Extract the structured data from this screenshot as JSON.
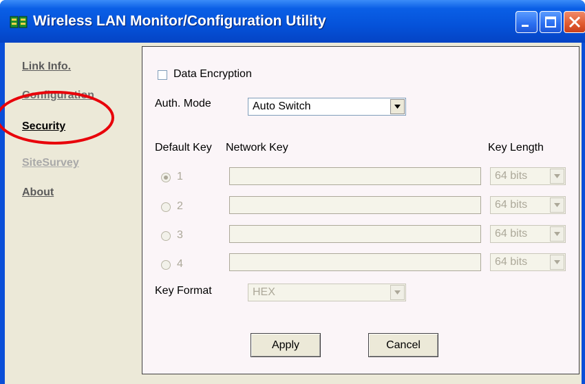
{
  "window": {
    "title": "Wireless LAN Monitor/Configuration Utility",
    "app_icon": "network-card-icon",
    "controls": [
      "minimize-icon",
      "maximize-icon",
      "close-icon"
    ]
  },
  "sidebar": {
    "items": [
      {
        "label": "Link Info.",
        "color": "#5a5a5a",
        "active": false
      },
      {
        "label": "Configuration",
        "color": "#6e6e6e",
        "active": false
      },
      {
        "label": "Security",
        "color": "#000000",
        "active": true
      },
      {
        "label": "SiteSurvey",
        "color": "#a8a8a8",
        "active": false
      },
      {
        "label": "About",
        "color": "#5a5a5a",
        "active": false
      }
    ]
  },
  "security": {
    "data_encryption_label": "Data Encryption",
    "data_encryption_checked": false,
    "auth_mode_label": "Auth. Mode",
    "auth_mode_value": "Auto Switch",
    "default_key_header": "Default Key",
    "network_key_header": "Network Key",
    "key_length_header": "Key Length",
    "keys": [
      {
        "index": "1",
        "selected": true,
        "value": "",
        "length": "64 bits"
      },
      {
        "index": "2",
        "selected": false,
        "value": "",
        "length": "64 bits"
      },
      {
        "index": "3",
        "selected": false,
        "value": "",
        "length": "64 bits"
      },
      {
        "index": "4",
        "selected": false,
        "value": "",
        "length": "64 bits"
      }
    ],
    "key_format_label": "Key Format",
    "key_format_value": "HEX",
    "apply_label": "Apply",
    "cancel_label": "Cancel"
  },
  "annotation": {
    "color": "#e8000a",
    "shape": "ellipse",
    "target": "Security"
  }
}
